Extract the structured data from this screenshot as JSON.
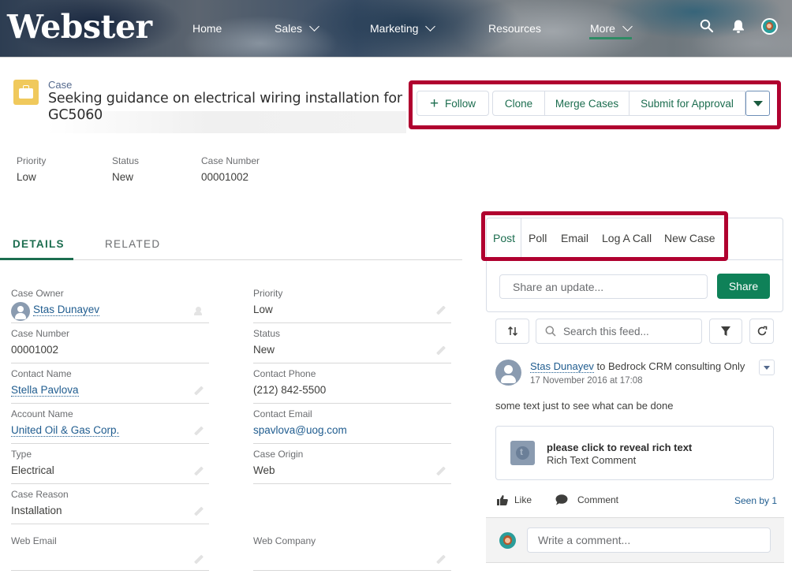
{
  "header": {
    "logo": "Webster",
    "nav": [
      {
        "label": "Home",
        "has_dropdown": false,
        "active": false
      },
      {
        "label": "Sales",
        "has_dropdown": true,
        "active": false
      },
      {
        "label": "Marketing",
        "has_dropdown": true,
        "active": false
      },
      {
        "label": "Resources",
        "has_dropdown": false,
        "active": false
      },
      {
        "label": "More",
        "has_dropdown": true,
        "active": true
      }
    ],
    "icons": [
      "search-icon",
      "bell-icon",
      "user-avatar"
    ]
  },
  "record": {
    "object_label": "Case",
    "title": "Seeking guidance on electrical wiring installation for GC5060",
    "actions": {
      "follow": "Follow",
      "buttons": [
        "Clone",
        "Merge Cases",
        "Submit for Approval"
      ]
    },
    "highlights": [
      {
        "label": "Priority",
        "value": "Low"
      },
      {
        "label": "Status",
        "value": "New"
      },
      {
        "label": "Case Number",
        "value": "00001002"
      }
    ]
  },
  "tabs": [
    {
      "label": "DETAILS",
      "active": true
    },
    {
      "label": "RELATED",
      "active": false
    }
  ],
  "details": {
    "left": [
      {
        "label": "Case Owner",
        "value": "Stas Dunayev",
        "link": true
      },
      {
        "label": "Case Number",
        "value": "00001002",
        "link": false
      },
      {
        "label": "Contact Name",
        "value": "Stella Pavlova",
        "link": true
      },
      {
        "label": "Account Name",
        "value": "United Oil & Gas Corp.",
        "link": true
      },
      {
        "label": "Type",
        "value": "Electrical",
        "link": false
      },
      {
        "label": "Case Reason",
        "value": "Installation",
        "link": false
      },
      {
        "label": "Web Email",
        "value": "",
        "link": false
      }
    ],
    "right": [
      {
        "label": "Priority",
        "value": "Low"
      },
      {
        "label": "Status",
        "value": "New"
      },
      {
        "label": "Contact Phone",
        "value": "(212) 842-5500"
      },
      {
        "label": "Contact Email",
        "value": "spavlova@uog.com"
      },
      {
        "label": "Case Origin",
        "value": "Web"
      },
      {
        "label": "Web Company",
        "value": ""
      }
    ]
  },
  "publisher": {
    "tabs": [
      "Post",
      "Poll",
      "Email",
      "Log A Call",
      "New Case"
    ],
    "active_tab": "Post",
    "placeholder": "Share an update...",
    "share_label": "Share"
  },
  "feed": {
    "search_placeholder": "Search this feed...",
    "post": {
      "author": "Stas Dunayev",
      "target": " to Bedrock CRM consulting Only",
      "timestamp": "17 November 2016 at 17:08",
      "body": "some text just to see what can be done",
      "attachment_title": "please click to reveal rich text",
      "attachment_subtitle": "Rich Text Comment",
      "like_label": "Like",
      "comment_label": "Comment",
      "seen_by": "Seen by 1",
      "comment_placeholder": "Write a comment..."
    }
  },
  "colors": {
    "brand_green": "#1c6d4f",
    "share_green": "#0f8158",
    "highlight_red": "#b0002f",
    "link_blue": "#1f5c8f",
    "case_icon": "#f0c95c"
  }
}
